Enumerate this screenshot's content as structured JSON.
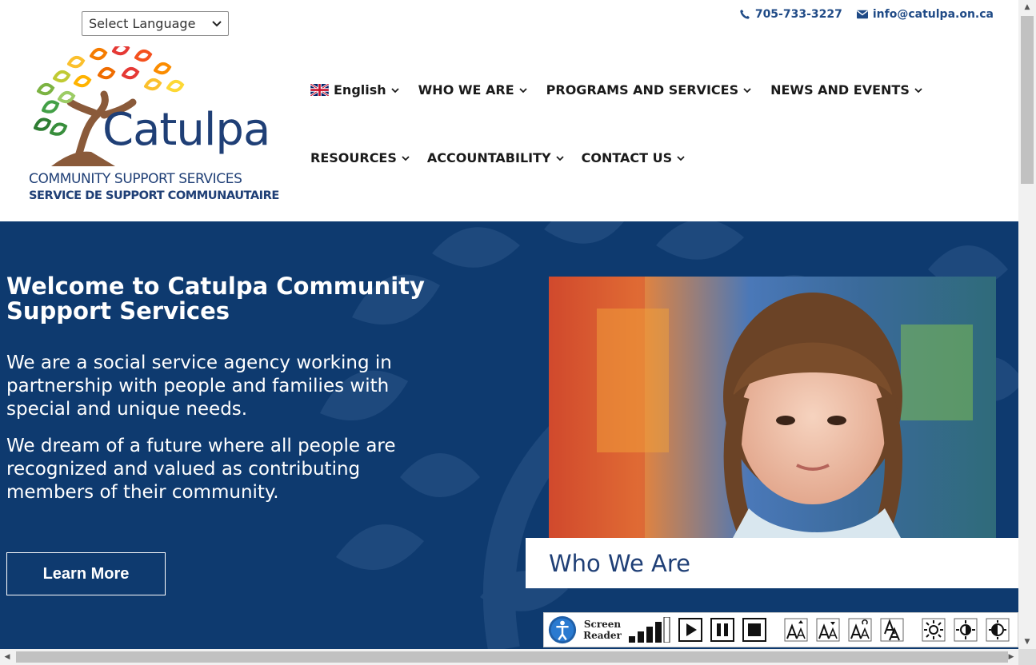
{
  "language_select": {
    "value": "Select Language"
  },
  "contact": {
    "phone": "705-733-3227",
    "email": "info@catulpa.on.ca"
  },
  "logo": {
    "brand": "Catulpa",
    "line_en": "COMMUNITY SUPPORT SERVICES",
    "line_fr": "SERVICE DE SUPPORT COMMUNAUTAIRE"
  },
  "nav": {
    "row1": [
      "English",
      "WHO WE ARE",
      "PROGRAMS AND SERVICES",
      "NEWS AND EVENTS"
    ],
    "row2": [
      "RESOURCES",
      "ACCOUNTABILITY",
      "CONTACT US"
    ]
  },
  "hero": {
    "title": "Welcome to Catulpa Community Support Services",
    "paragraph1": "We are a social service agency working in partnership with people and families with special and unique needs.",
    "paragraph2": "We dream of a future where all people are recognized and valued as contributing members of their community.",
    "button": "Learn More",
    "card_title": "Who We Are"
  },
  "toolbar": {
    "screen_reader_label_1": "Screen",
    "screen_reader_label_2": "Reader"
  },
  "colors": {
    "navy": "#0e3a6f",
    "brand_blue": "#1f3f76",
    "link_blue": "#1f4a86"
  }
}
